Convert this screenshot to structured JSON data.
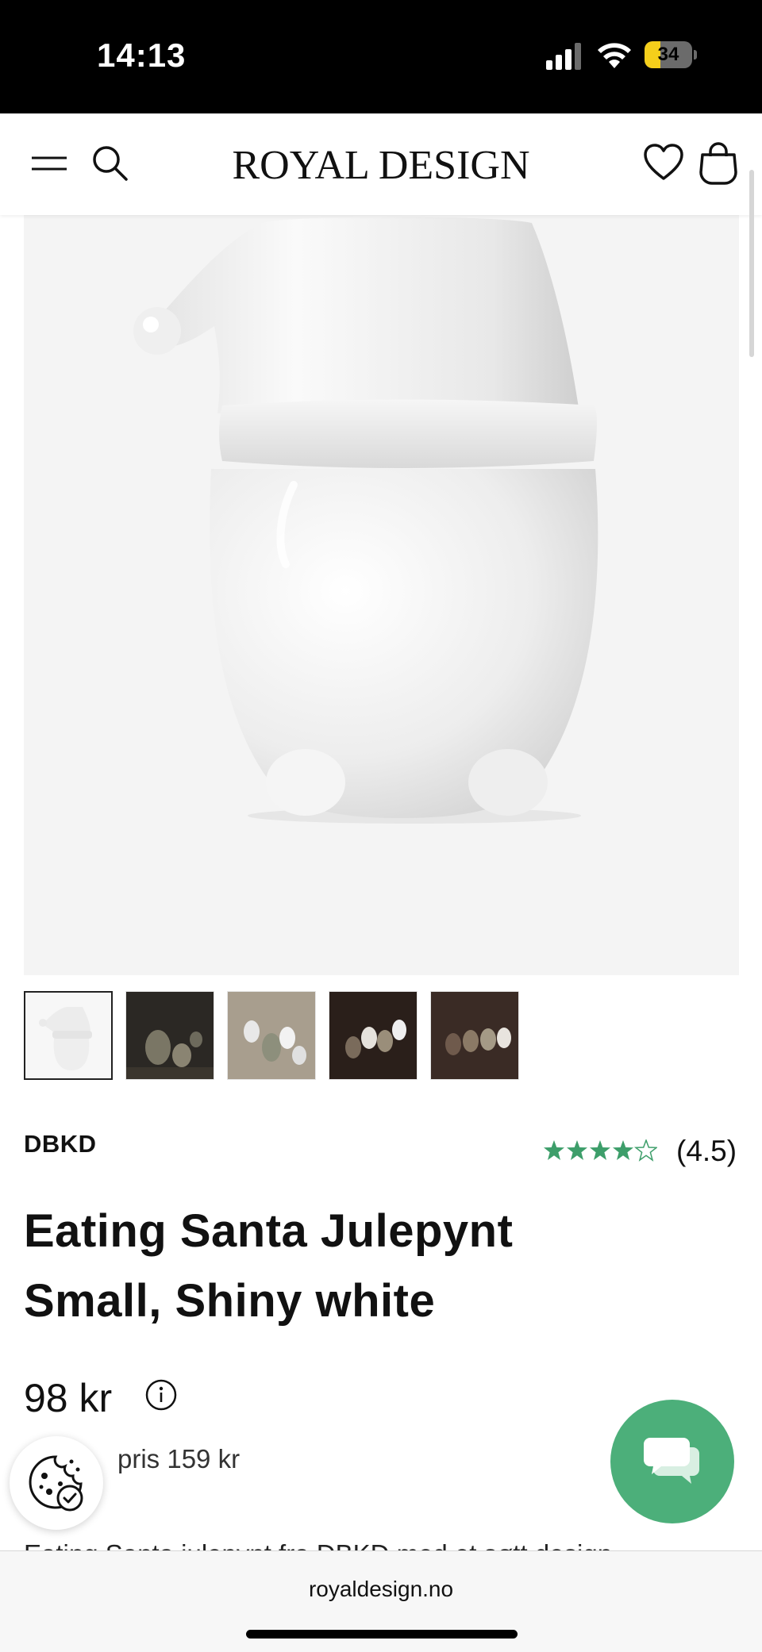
{
  "status_bar": {
    "time": "14:13",
    "battery": "34",
    "battery_level": 0.34
  },
  "header": {
    "logo": "ROYAL DESIGN",
    "menu_icon": "hamburger-menu-icon",
    "search_icon": "search-icon",
    "wishlist_icon": "heart-icon",
    "cart_icon": "shopping-bag-icon"
  },
  "product": {
    "brand": "DBKD",
    "rating_stars": 4.5,
    "rating_text": "(4.5)",
    "title_line1": "Eating Santa Julepynt",
    "title_line2": "Small, Shiny white",
    "price": "98 kr",
    "previous_price": "pris 159 kr",
    "description_snippet": "Eating Santa julepynt fra DBKD med et søtt design"
  },
  "thumbnails": [
    "thumbnail-1",
    "thumbnail-2",
    "thumbnail-3",
    "thumbnail-4",
    "thumbnail-5"
  ],
  "browser": {
    "url": "royaldesign.no"
  },
  "colors": {
    "accent_green": "#4caf7a",
    "star_green": "#3d9e6a",
    "battery_yellow": "#f5cf1b"
  }
}
